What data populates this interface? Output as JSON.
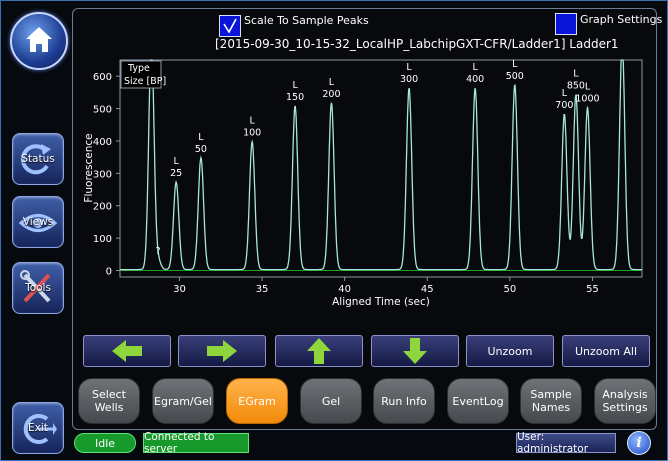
{
  "sidebar": {
    "home_icon": "home-icon",
    "status_label": "Status",
    "views_label": "Views",
    "tools_label": "Tools",
    "exit_label": "Exit"
  },
  "header": {
    "scale_label": "Scale To Sample Peaks",
    "scale_checked": true,
    "graph_settings_label": "Graph Settings"
  },
  "chart_title": "[2015-09-30_10-15-32_LocalHP_LabchipGXT-CFR/Ladder1] Ladder1",
  "chart_data": {
    "type": "line",
    "title": "[2015-09-30_10-15-32_LocalHP_LabchipGXT-CFR/Ladder1] Ladder1",
    "xlabel": "Aligned Time (sec)",
    "ylabel": "Fluorescence",
    "xlim": [
      26.4,
      58
    ],
    "ylim": [
      -20,
      650
    ],
    "x_ticks": [
      30,
      35,
      40,
      45,
      50,
      55
    ],
    "y_ticks": [
      0,
      100,
      200,
      300,
      400,
      500,
      600
    ],
    "grid": false,
    "legend_box": [
      "Type",
      "Size [BP]"
    ],
    "line_color": "#a8e6dc",
    "baseline_color": "#1fa01f",
    "peaks": [
      {
        "x": 28.3,
        "y": 700,
        "type": "",
        "size": ""
      },
      {
        "x": 28.7,
        "y": 30,
        "type": "?",
        "size": ""
      },
      {
        "x": 29.8,
        "y": 270,
        "type": "L",
        "size": "25"
      },
      {
        "x": 31.3,
        "y": 345,
        "type": "L",
        "size": "50"
      },
      {
        "x": 34.4,
        "y": 395,
        "type": "L",
        "size": "100"
      },
      {
        "x": 37.0,
        "y": 505,
        "type": "L",
        "size": "150"
      },
      {
        "x": 39.2,
        "y": 515,
        "type": "L",
        "size": "200"
      },
      {
        "x": 43.9,
        "y": 560,
        "type": "L",
        "size": "300"
      },
      {
        "x": 47.9,
        "y": 560,
        "type": "L",
        "size": "400"
      },
      {
        "x": 50.3,
        "y": 570,
        "type": "L",
        "size": "500"
      },
      {
        "x": 53.3,
        "y": 480,
        "type": "L",
        "size": "700"
      },
      {
        "x": 54.0,
        "y": 540,
        "type": "L",
        "size": "850"
      },
      {
        "x": 54.7,
        "y": 500,
        "type": "L",
        "size": "1000"
      },
      {
        "x": 56.8,
        "y": 700,
        "type": "",
        "size": ""
      }
    ]
  },
  "nav": {
    "left_icon": "arrow-left-icon",
    "right_icon": "arrow-right-icon",
    "up_icon": "arrow-up-icon",
    "down_icon": "arrow-down-icon",
    "unzoom_label": "Unzoom",
    "unzoom_all_label": "Unzoom All",
    "arrow_color": "#8fd63c"
  },
  "tabs": [
    {
      "label": "Select Wells",
      "active": false
    },
    {
      "label": "Egram/Gel",
      "active": false
    },
    {
      "label": "EGram",
      "active": true
    },
    {
      "label": "Gel",
      "active": false
    },
    {
      "label": "Run Info",
      "active": false
    },
    {
      "label": "EventLog",
      "active": false
    },
    {
      "label": "Sample Names",
      "active": false
    },
    {
      "label": "Analysis Settings",
      "active": false
    }
  ],
  "status": {
    "state": "Idle",
    "connection": "Connected to server",
    "user": "User: administrator",
    "info_icon": "info-icon"
  }
}
